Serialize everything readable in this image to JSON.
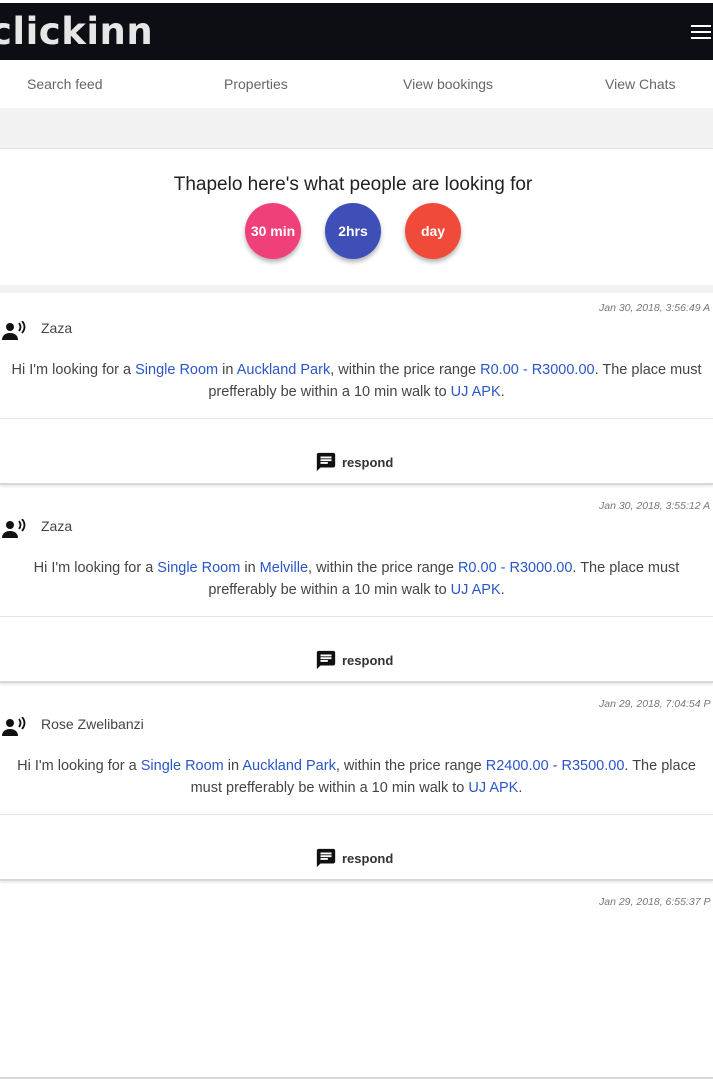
{
  "app": {
    "brand": "clickinn"
  },
  "tabs": [
    {
      "label": "Search feed"
    },
    {
      "label": "Properties"
    },
    {
      "label": "View bookings"
    },
    {
      "label": "View Chats"
    }
  ],
  "hero": {
    "heading": "Thapelo here's what people are looking for",
    "filters": [
      {
        "label": "30 min",
        "color": "#f0407a"
      },
      {
        "label": "2hrs",
        "color": "#3f4fb8"
      },
      {
        "label": "day",
        "color": "#f04a3a"
      }
    ]
  },
  "feed": [
    {
      "timestamp": "Jan 30, 2018, 3:56:49 A",
      "user": "Zaza",
      "intro": "Hi I'm looking for a",
      "room_type": "Single Room",
      "in": "in",
      "area": "Auckland Park",
      "price_text": ", within the price range",
      "price_range": "R0.00 - R3000.00",
      "walk_text": ". The place must prefferably be within a 10 min walk to",
      "campus": "UJ APK",
      "end": ".",
      "respond_label": "respond"
    },
    {
      "timestamp": "Jan 30, 2018, 3:55:12 A",
      "user": "Zaza",
      "intro": "Hi I'm looking for a",
      "room_type": "Single Room",
      "in": "in",
      "area": "Melville",
      "price_text": ", within the price range",
      "price_range": "R0.00 - R3000.00",
      "walk_text": ". The place must prefferably be within a 10 min walk to",
      "campus": "UJ APK",
      "end": ".",
      "respond_label": "respond"
    },
    {
      "timestamp": "Jan 29, 2018, 7:04:54 P",
      "user": "Rose Zwelibanzi",
      "intro": "Hi I'm looking for a",
      "room_type": "Single Room",
      "in": "in",
      "area": "Auckland Park",
      "price_text": ", within the price range",
      "price_range": "R2400.00 - R3500.00",
      "walk_text": ". The place must prefferably be within a 10 min walk to",
      "campus": "UJ APK",
      "end": ".",
      "respond_label": "respond"
    },
    {
      "timestamp": "Jan 29, 2018, 6:55:37 P"
    }
  ]
}
